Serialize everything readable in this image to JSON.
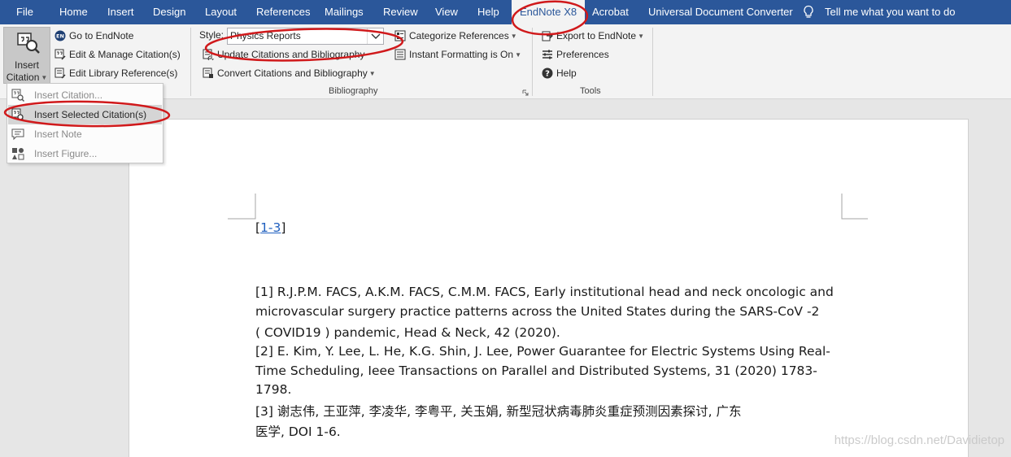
{
  "tabs": [
    {
      "label": "File"
    },
    {
      "label": "Home"
    },
    {
      "label": "Insert"
    },
    {
      "label": "Design"
    },
    {
      "label": "Layout"
    },
    {
      "label": "References"
    },
    {
      "label": "Mailings"
    },
    {
      "label": "Review"
    },
    {
      "label": "View"
    },
    {
      "label": "Help"
    },
    {
      "label": "EndNote X8"
    },
    {
      "label": "Acrobat"
    },
    {
      "label": "Universal Document Converter"
    }
  ],
  "tell_me": "Tell me what you want to do",
  "ribbon": {
    "insert_citation_line1": "Insert",
    "insert_citation_line2": "Citation",
    "go_to_endnote": "Go to EndNote",
    "edit_manage": "Edit & Manage Citation(s)",
    "edit_library": "Edit Library Reference(s)",
    "style_label": "Style:",
    "style_value": "Physics Reports",
    "update_citations": "Update Citations and Bibliography",
    "convert_citations": "Convert Citations and Bibliography",
    "categorize": "Categorize References",
    "instant_formatting": "Instant Formatting is On",
    "bibliography_label": "Bibliography",
    "export": "Export to EndNote",
    "preferences": "Preferences",
    "help": "Help",
    "tools_label": "Tools"
  },
  "menu": {
    "items": [
      {
        "label": "Insert Citation...",
        "highlighted": false
      },
      {
        "label": "Insert Selected Citation(s)",
        "highlighted": true
      },
      {
        "label": "Insert Note",
        "highlighted": false
      },
      {
        "label": "Insert Figure...",
        "highlighted": false
      }
    ]
  },
  "document": {
    "citation_open": "[",
    "citation_link": "1-3",
    "citation_close": "]",
    "lines": [
      "[1] R.J.P.M. FACS, A.K.M. FACS, C.M.M. FACS, Early institutional head and neck oncologic and",
      "microvascular surgery practice patterns across the United States during the SARS-CoV -2",
      "( COVID19 ) pandemic, Head & Neck, 42 (2020).",
      "[2] E. Kim, Y. Lee, L. He, K.G. Shin, J. Lee, Power Guarantee for Electric Systems Using Real-",
      "Time Scheduling, Ieee Transactions on Parallel and Distributed Systems, 31 (2020) 1783-",
      "1798.",
      "[3] 谢志伟, 王亚萍, 李凌华, 李粤平, 关玉娟, 新型冠状病毒肺炎重症预测因素探讨, 广东",
      "医学, DOI  1-6."
    ]
  },
  "watermark": "https://blog.csdn.net/Davidietop",
  "colors": {
    "tab_bar": "#2b579a",
    "ribbon": "#f3f3f3",
    "annotation": "#d0191b",
    "link": "#1f5fbf"
  }
}
